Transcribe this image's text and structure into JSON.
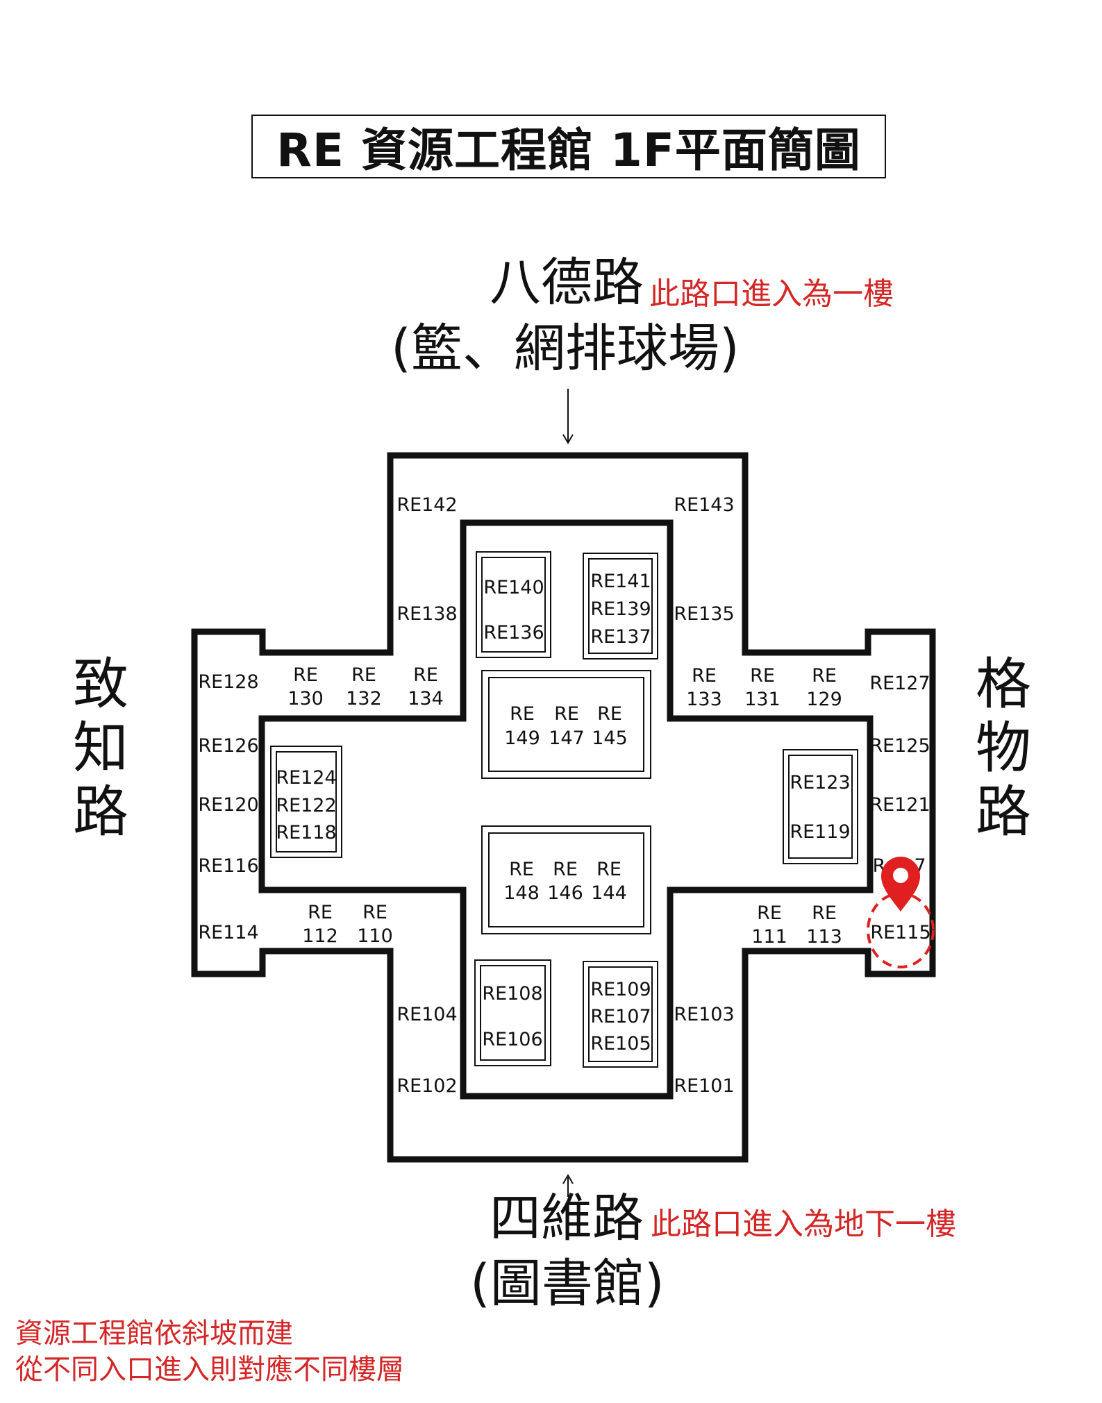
{
  "title": "RE 資源工程館 1F平面簡圖",
  "roads": {
    "north": {
      "name": "八德路",
      "sub": "(籃、網排球場)",
      "note": "此路口進入為一樓"
    },
    "south": {
      "name": "四維路",
      "sub": "(圖書館)",
      "note": "此路口進入為地下一樓"
    },
    "west": {
      "name": "致知路"
    },
    "east": {
      "name": "格物路"
    }
  },
  "footnote": [
    "資源工程館依斜坡而建",
    "從不同入口進入則對應不同樓層"
  ],
  "marker": {
    "room": "RE115",
    "color": "#e02020",
    "icon": "map-pin-icon"
  },
  "rooms": {
    "re142": "RE142",
    "re143": "RE143",
    "re138": "RE138",
    "re135": "RE135",
    "re128": "RE128",
    "re127": "RE127",
    "re126": "RE126",
    "re125": "RE125",
    "re120": "RE120",
    "re121": "RE121",
    "re116": "RE116",
    "re117_partial": "R",
    "re117_tail": "7",
    "re114": "RE114",
    "re115": "RE115",
    "re104": "RE104",
    "re103": "RE103",
    "re102": "RE102",
    "re101": "RE101",
    "re130": [
      "RE",
      "130"
    ],
    "re132": [
      "RE",
      "132"
    ],
    "re134": [
      "RE",
      "134"
    ],
    "re133": [
      "RE",
      "133"
    ],
    "re131": [
      "RE",
      "131"
    ],
    "re129": [
      "RE",
      "129"
    ],
    "re112": [
      "RE",
      "112"
    ],
    "re110": [
      "RE",
      "110"
    ],
    "re111": [
      "RE",
      "111"
    ],
    "re113": [
      "RE",
      "113"
    ],
    "box_140_136": [
      "RE140",
      "RE136"
    ],
    "box_141_139_137": [
      "RE141",
      "RE139",
      "RE137"
    ],
    "box_149_147_145": {
      "top": [
        "RE",
        "RE",
        "RE"
      ],
      "bottom": [
        "149",
        "147",
        "145"
      ]
    },
    "box_148_146_144": {
      "top": [
        "RE",
        "RE",
        "RE"
      ],
      "bottom": [
        "148",
        "146",
        "144"
      ]
    },
    "box_124_122_118": [
      "RE124",
      "RE122",
      "RE118"
    ],
    "box_123_119": [
      "RE123",
      "RE119"
    ],
    "box_108_106": [
      "RE108",
      "RE106"
    ],
    "box_109_107_105": [
      "RE109",
      "RE107",
      "RE105"
    ]
  }
}
